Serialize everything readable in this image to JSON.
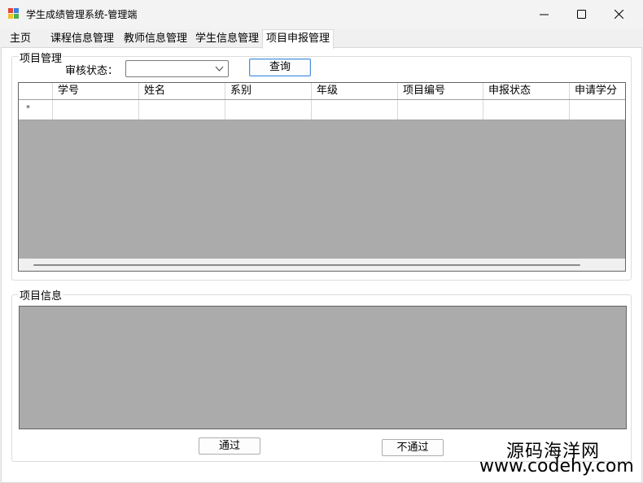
{
  "window": {
    "title": "学生成绩管理系统-管理端"
  },
  "tabs": [
    {
      "label": "主页"
    },
    {
      "label": "课程信息管理"
    },
    {
      "label": "教师信息管理"
    },
    {
      "label": "学生信息管理"
    },
    {
      "label": "项目申报管理",
      "active": true
    }
  ],
  "project_management": {
    "legend": "项目管理",
    "filter_label": "审核状态：",
    "filter_value": "",
    "query_button": "查询"
  },
  "grid": {
    "columns": [
      "学号",
      "姓名",
      "系别",
      "年级",
      "项目编号",
      "申报状态",
      "申请学分"
    ],
    "new_row_marker": "*",
    "rows": []
  },
  "project_info": {
    "legend": "项目信息",
    "pass_button": "通过",
    "reject_button": "不通过"
  },
  "watermark": {
    "main": "源码海洋网",
    "url": "www.codehy.com"
  },
  "colors": {
    "grid_background": "#ababab",
    "focus_border": "#4a8fd9"
  }
}
